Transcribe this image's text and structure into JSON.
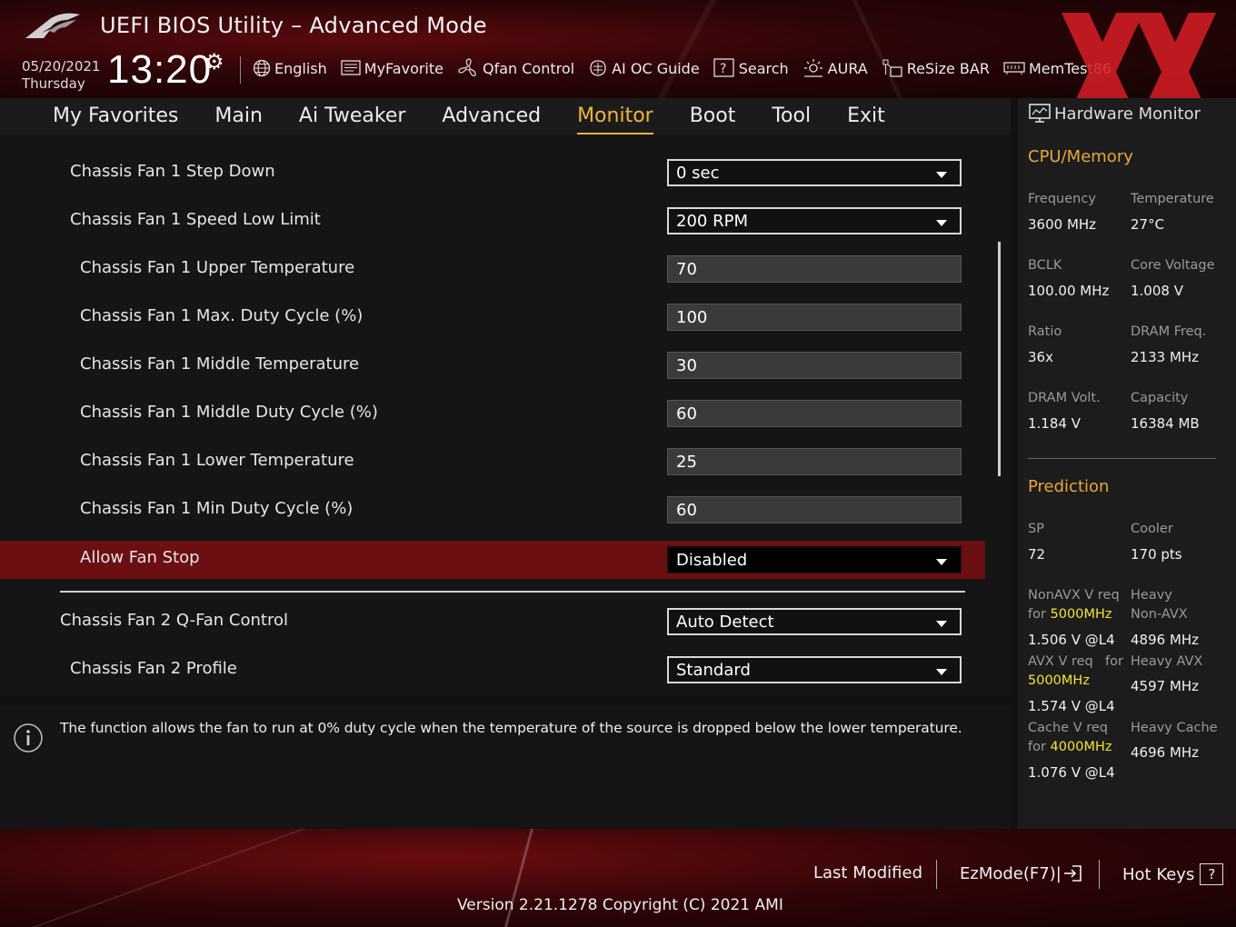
{
  "header": {
    "title": "UEFI BIOS Utility – Advanced Mode",
    "date": "05/20/2021",
    "day": "Thursday",
    "time": "13:20",
    "toolbar": [
      {
        "label": "English",
        "icon": "globe-icon"
      },
      {
        "label": "MyFavorite",
        "icon": "favorite-icon"
      },
      {
        "label": "Qfan Control",
        "icon": "fan-icon"
      },
      {
        "label": "AI OC Guide",
        "icon": "ai-oc-icon"
      },
      {
        "label": "Search",
        "icon": "search-icon"
      },
      {
        "label": "AURA",
        "icon": "aura-icon"
      },
      {
        "label": "ReSize BAR",
        "icon": "resize-bar-icon"
      },
      {
        "label": "MemTest86",
        "icon": "memtest-icon"
      }
    ]
  },
  "tabs": [
    {
      "label": "My Favorites"
    },
    {
      "label": "Main"
    },
    {
      "label": "Ai Tweaker"
    },
    {
      "label": "Advanced"
    },
    {
      "label": "Monitor",
      "active": true
    },
    {
      "label": "Boot"
    },
    {
      "label": "Tool"
    },
    {
      "label": "Exit"
    }
  ],
  "settings": [
    {
      "label": "Chassis Fan 1 Step Down",
      "value": "0 sec",
      "type": "dropdown"
    },
    {
      "label": "Chassis Fan 1 Speed Low Limit",
      "value": "200 RPM",
      "type": "dropdown"
    },
    {
      "label": "Chassis Fan 1 Upper Temperature",
      "value": "70",
      "type": "number"
    },
    {
      "label": "Chassis Fan 1 Max. Duty Cycle (%)",
      "value": "100",
      "type": "number"
    },
    {
      "label": "Chassis Fan 1 Middle Temperature",
      "value": "30",
      "type": "number"
    },
    {
      "label": "Chassis Fan 1 Middle Duty Cycle (%)",
      "value": "60",
      "type": "number"
    },
    {
      "label": "Chassis Fan 1 Lower Temperature",
      "value": "25",
      "type": "number"
    },
    {
      "label": "Chassis Fan 1 Min Duty Cycle (%)",
      "value": "60",
      "type": "number"
    },
    {
      "label": "Allow Fan Stop",
      "value": "Disabled",
      "type": "dropdown",
      "selected": true
    },
    {
      "label": "Chassis Fan 2 Q-Fan Control",
      "value": "Auto Detect",
      "type": "dropdown"
    },
    {
      "label": "Chassis Fan 2 Profile",
      "value": "Standard",
      "type": "dropdown"
    }
  ],
  "info": {
    "text": "The function allows the fan to run at 0% duty cycle when the temperature of the source is dropped below the lower temperature."
  },
  "hardware_monitor": {
    "title": "Hardware Monitor",
    "cpu_memory": {
      "heading": "CPU/Memory",
      "frequency_label": "Frequency",
      "frequency": "3600 MHz",
      "temperature_label": "Temperature",
      "temperature": "27°C",
      "bclk_label": "BCLK",
      "bclk": "100.00 MHz",
      "core_voltage_label": "Core Voltage",
      "core_voltage": "1.008 V",
      "ratio_label": "Ratio",
      "ratio": "36x",
      "dram_freq_label": "DRAM Freq.",
      "dram_freq": "2133 MHz",
      "dram_volt_label": "DRAM Volt.",
      "dram_volt": "1.184 V",
      "capacity_label": "Capacity",
      "capacity": "16384 MB"
    },
    "prediction": {
      "heading": "Prediction",
      "sp_label": "SP",
      "sp": "72",
      "cooler_label": "Cooler",
      "cooler": "170 pts",
      "nonavx_label_1": "NonAVX V req",
      "nonavx_label_2_prefix": "for ",
      "nonavx_freq": "5000MHz",
      "nonavx_v": "1.506 V @L4",
      "heavy_nonavx_label_1": "Heavy",
      "heavy_nonavx_label_2": "Non-AVX",
      "heavy_nonavx": "4896 MHz",
      "avx_label_1": "AVX V req",
      "avx_label_for": "for",
      "avx_freq": "5000MHz",
      "avx_v": "1.574 V @L4",
      "heavy_avx_label": "Heavy AVX",
      "heavy_avx": "4597 MHz",
      "cache_label_1": "Cache V req",
      "cache_label_2_prefix": "for ",
      "cache_freq": "4000MHz",
      "cache_v": "1.076 V @L4",
      "heavy_cache_label": "Heavy Cache",
      "heavy_cache": "4696 MHz"
    }
  },
  "footer": {
    "last_modified": "Last Modified",
    "ezmode": "EzMode(F7)|",
    "hotkeys": "Hot Keys",
    "hotkeys_key": "?",
    "version": "Version 2.21.1278 Copyright (C) 2021 AMI"
  },
  "colors": {
    "accent": "#f0b43c",
    "selected_row": "#6b0f13",
    "highlight_yellow": "#f5e13a"
  }
}
